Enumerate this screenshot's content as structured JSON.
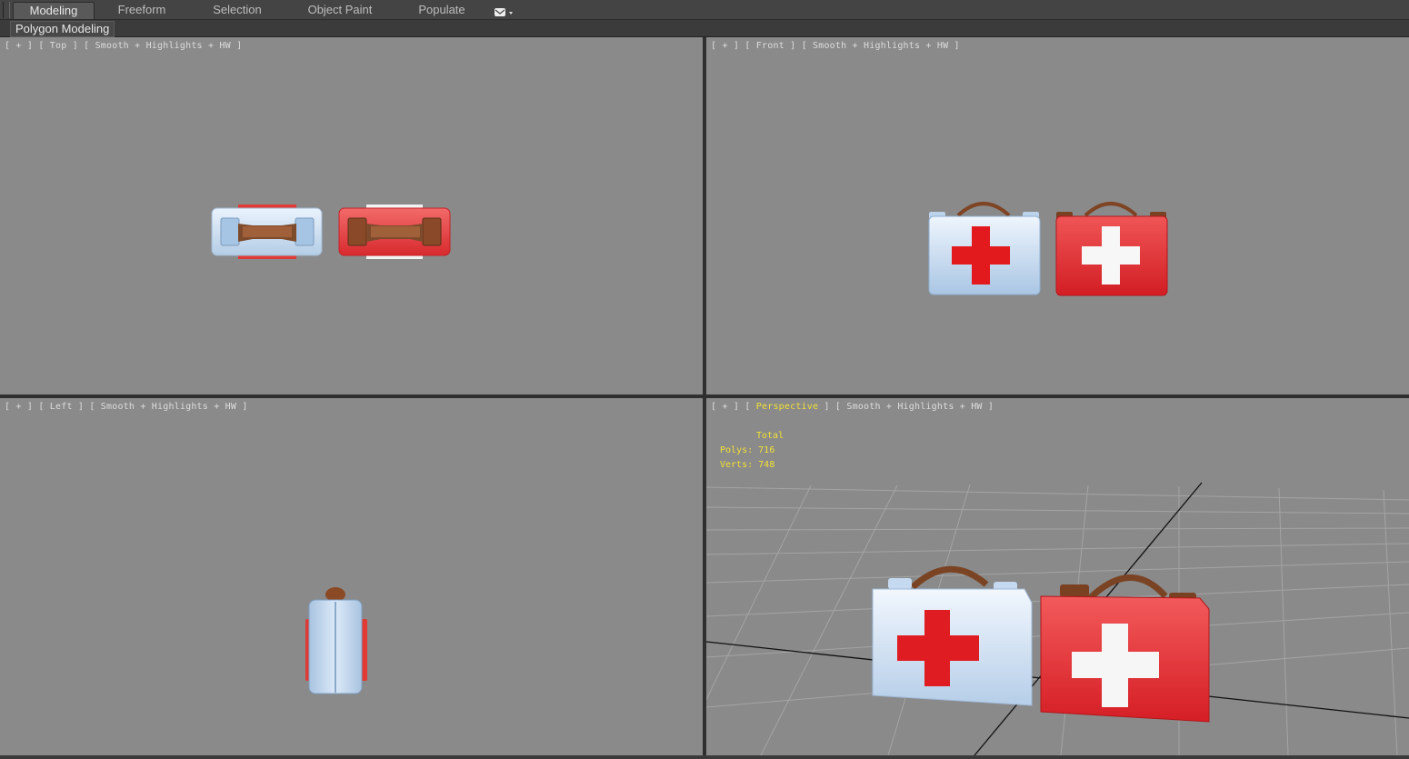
{
  "ribbon": {
    "tabs": [
      {
        "label": "Modeling",
        "active": true
      },
      {
        "label": "Freeform",
        "active": false
      },
      {
        "label": "Selection",
        "active": false
      },
      {
        "label": "Object Paint",
        "active": false
      },
      {
        "label": "Populate",
        "active": false
      }
    ],
    "dropdown_icon": "mail-dropdown-icon"
  },
  "subpanel": {
    "label": "Polygon Modeling"
  },
  "viewports": {
    "top": {
      "plus": "+",
      "name": "Top",
      "shading": "Smooth + Highlights + HW"
    },
    "front": {
      "plus": "+",
      "name": "Front",
      "shading": "Smooth + Highlights + HW"
    },
    "left": {
      "plus": "+",
      "name": "Left",
      "shading": "Smooth + Highlights + HW"
    },
    "perspective": {
      "plus": "+",
      "name": "Perspective",
      "shading": "Smooth + Highlights + HW"
    }
  },
  "stats": {
    "header": "Total",
    "polys_label": "Polys:",
    "polys_value": "716",
    "verts_label": "Verts:",
    "verts_value": "748"
  },
  "colors": {
    "viewport_bg": "#8a8a8a",
    "active_viewport_text": "#f2e036",
    "kit_blue": "#c9ddf3",
    "kit_red": "#e8373a",
    "handle_brown": "#8a4a26"
  }
}
